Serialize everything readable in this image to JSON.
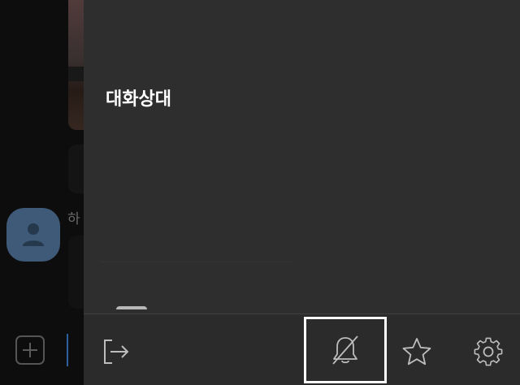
{
  "background_chat": {
    "contact_name_partial": "하"
  },
  "drawer": {
    "title": "대화상대",
    "toolbar": {
      "exit_icon": "exit-icon",
      "mute_icon": "bell-off-icon",
      "favorite_icon": "star-icon",
      "settings_icon": "gear-icon"
    }
  },
  "colors": {
    "drawer_bg": "#2e2e2e",
    "toolbar_bg": "#2b2b2b",
    "highlight_border": "#ffffff",
    "icon_color": "#bdbdbd",
    "avatar_bg": "#3e5a78"
  }
}
